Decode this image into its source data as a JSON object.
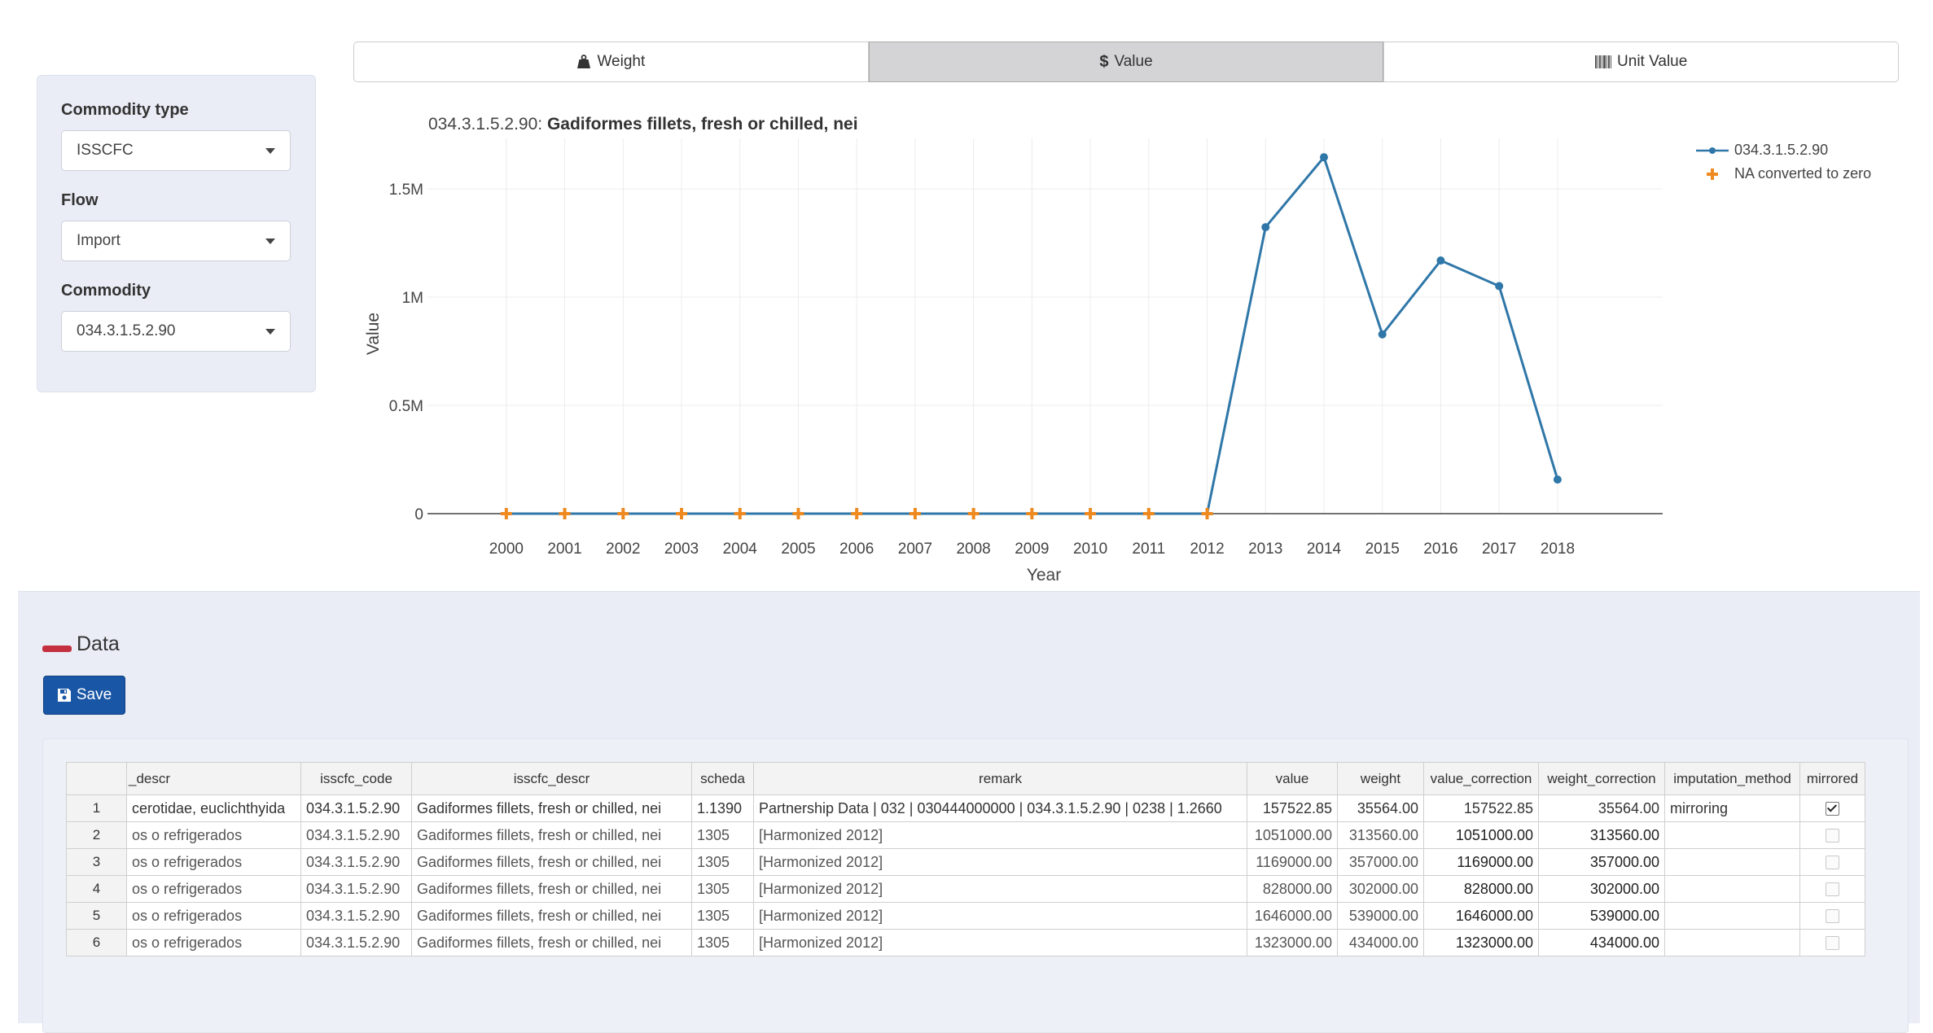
{
  "sidebar": {
    "commodity_type": {
      "label": "Commodity type",
      "value": "ISSCFC"
    },
    "flow": {
      "label": "Flow",
      "value": "Import"
    },
    "commodity": {
      "label": "Commodity",
      "value": "034.3.1.5.2.90"
    }
  },
  "tabs": [
    {
      "label": "Weight",
      "icon": "weight-icon",
      "active": false
    },
    {
      "label": "Value",
      "icon": "dollar-icon",
      "active": true
    },
    {
      "label": "Unit Value",
      "icon": "barcode-icon",
      "active": false
    }
  ],
  "chart_data": {
    "type": "line",
    "title_prefix": "034.3.1.5.2.90:",
    "title": "Gadiformes fillets, fresh or chilled, nei",
    "xlabel": "Year",
    "ylabel": "Value",
    "ylim": [
      0,
      1700000
    ],
    "yticks": [
      {
        "value": 0,
        "label": "0"
      },
      {
        "value": 500000,
        "label": "0.5M"
      },
      {
        "value": 1000000,
        "label": "1M"
      },
      {
        "value": 1500000,
        "label": "1.5M"
      }
    ],
    "x": [
      2000,
      2001,
      2002,
      2003,
      2004,
      2005,
      2006,
      2007,
      2008,
      2009,
      2010,
      2011,
      2012,
      2013,
      2014,
      2015,
      2016,
      2017,
      2018
    ],
    "series": [
      {
        "name": "034.3.1.5.2.90",
        "color": "#2f77a8",
        "values": [
          0,
          0,
          0,
          0,
          0,
          0,
          0,
          0,
          0,
          0,
          0,
          0,
          0,
          1323000,
          1646000,
          828000,
          1169000,
          1051000,
          157522.85
        ]
      },
      {
        "name": "NA converted to zero",
        "color": "#ee8a1f",
        "marker": "cross",
        "x": [
          2000,
          2001,
          2002,
          2003,
          2004,
          2005,
          2006,
          2007,
          2008,
          2009,
          2010,
          2011,
          2012
        ],
        "values": [
          0,
          0,
          0,
          0,
          0,
          0,
          0,
          0,
          0,
          0,
          0,
          0,
          0
        ]
      }
    ],
    "grid": true,
    "legend_position": "top-right"
  },
  "data_section": {
    "title": "Data",
    "save_label": "Save"
  },
  "table": {
    "columns": [
      "",
      "_descr",
      "isscfc_code",
      "isscfc_descr",
      "scheda",
      "remark",
      "value",
      "weight",
      "value_correction",
      "weight_correction",
      "imputation_method",
      "mirrored"
    ],
    "rows": [
      {
        "n": "1",
        "descr": "cerotidae, euclichthyida",
        "code": "034.3.1.5.2.90",
        "cdescr": "Gadiformes fillets, fresh or chilled, nei",
        "scheda": "1.1390",
        "remark": "Partnership Data | 032 | 030444000000 | 034.3.1.5.2.90 | 0238 | 1.2660",
        "value": "157522.85",
        "weight": "35564.00",
        "value_correction": "157522.85",
        "weight_correction": "35564.00",
        "imputation_method": "mirroring",
        "mirrored": true
      },
      {
        "n": "2",
        "descr": "os o refrigerados",
        "code": "034.3.1.5.2.90",
        "cdescr": "Gadiformes fillets, fresh or chilled, nei",
        "scheda": "1305",
        "remark": "[Harmonized 2012]",
        "value": "1051000.00",
        "weight": "313560.00",
        "value_correction": "1051000.00",
        "weight_correction": "313560.00",
        "imputation_method": "",
        "mirrored": false
      },
      {
        "n": "3",
        "descr": "os o refrigerados",
        "code": "034.3.1.5.2.90",
        "cdescr": "Gadiformes fillets, fresh or chilled, nei",
        "scheda": "1305",
        "remark": "[Harmonized 2012]",
        "value": "1169000.00",
        "weight": "357000.00",
        "value_correction": "1169000.00",
        "weight_correction": "357000.00",
        "imputation_method": "",
        "mirrored": false
      },
      {
        "n": "4",
        "descr": "os o refrigerados",
        "code": "034.3.1.5.2.90",
        "cdescr": "Gadiformes fillets, fresh or chilled, nei",
        "scheda": "1305",
        "remark": "[Harmonized 2012]",
        "value": "828000.00",
        "weight": "302000.00",
        "value_correction": "828000.00",
        "weight_correction": "302000.00",
        "imputation_method": "",
        "mirrored": false
      },
      {
        "n": "5",
        "descr": "os o refrigerados",
        "code": "034.3.1.5.2.90",
        "cdescr": "Gadiformes fillets, fresh or chilled, nei",
        "scheda": "1305",
        "remark": "[Harmonized 2012]",
        "value": "1646000.00",
        "weight": "539000.00",
        "value_correction": "1646000.00",
        "weight_correction": "539000.00",
        "imputation_method": "",
        "mirrored": false
      },
      {
        "n": "6",
        "descr": "os o refrigerados",
        "code": "034.3.1.5.2.90",
        "cdescr": "Gadiformes fillets, fresh or chilled, nei",
        "scheda": "1305",
        "remark": "[Harmonized 2012]",
        "value": "1323000.00",
        "weight": "434000.00",
        "value_correction": "1323000.00",
        "weight_correction": "434000.00",
        "imputation_method": "",
        "mirrored": false
      }
    ]
  }
}
